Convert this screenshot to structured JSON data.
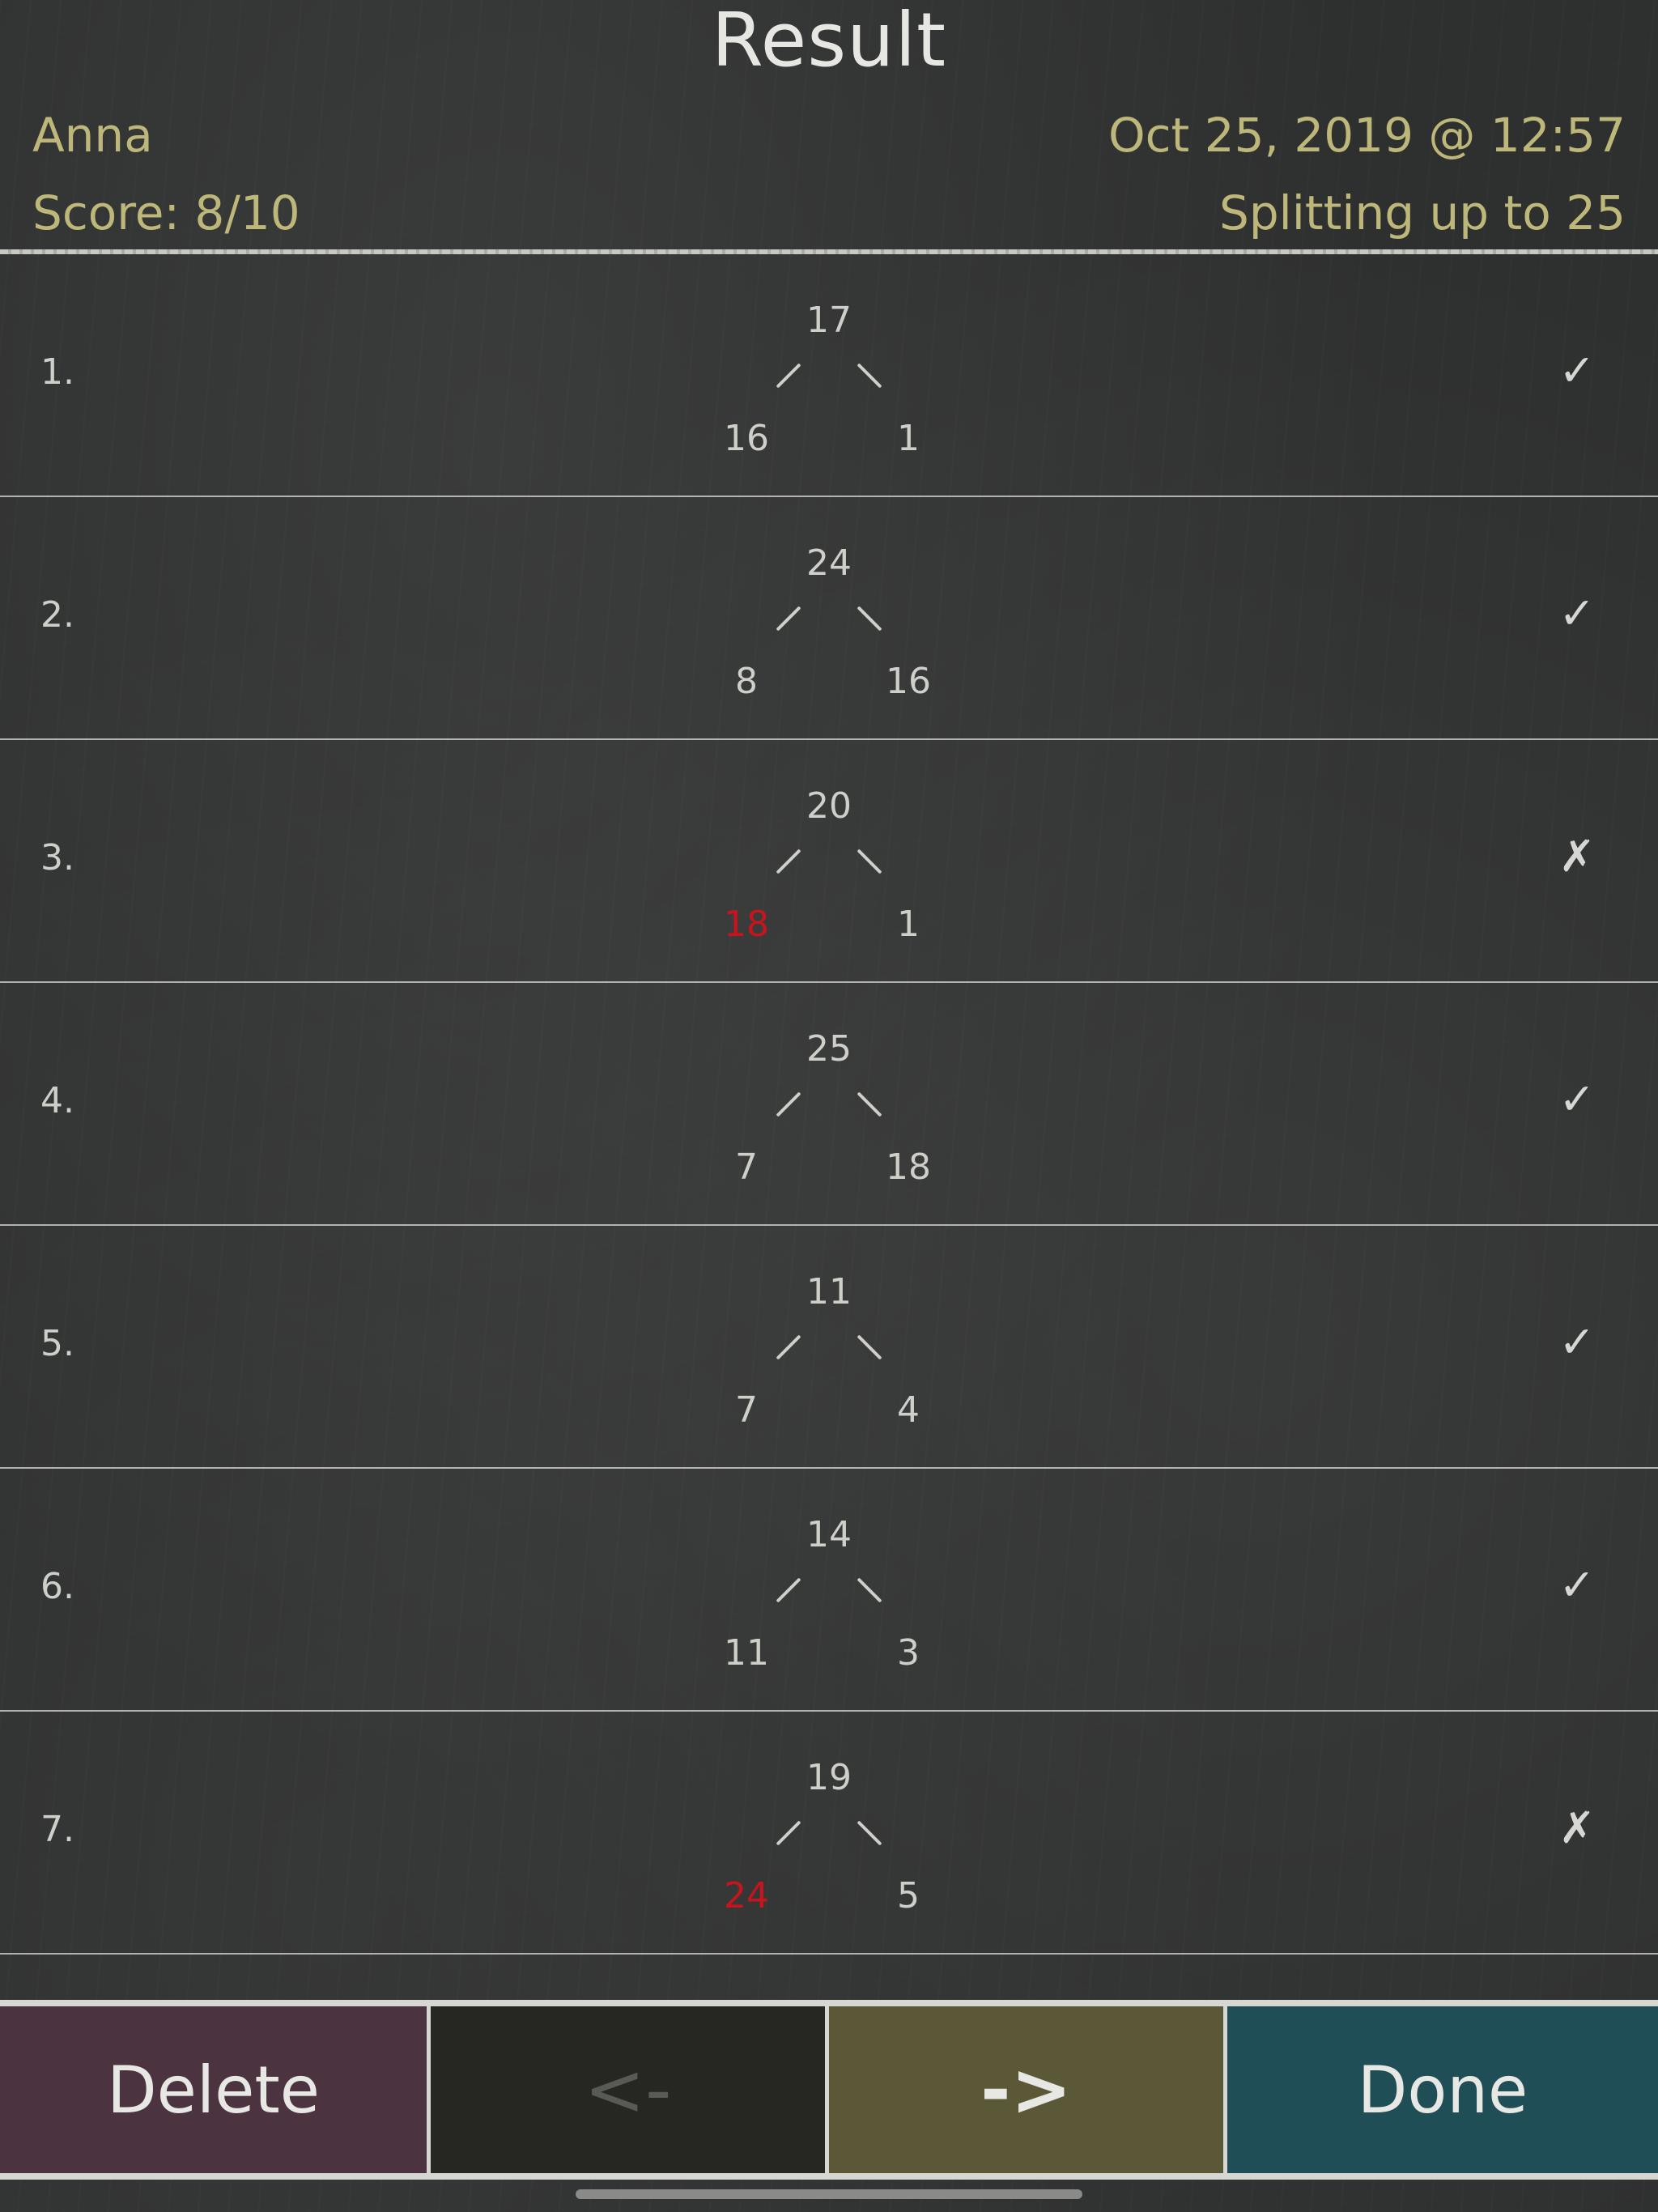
{
  "title": "Result",
  "meta": {
    "name": "Anna",
    "datetime": "Oct 25, 2019 @ 12:57",
    "score": "Score: 8/10",
    "mode": "Splitting up to 25"
  },
  "rows": [
    {
      "index": "1.",
      "total": "17",
      "left": "16",
      "right": "1",
      "mark": "✓",
      "left_wrong": false,
      "right_wrong": false
    },
    {
      "index": "2.",
      "total": "24",
      "left": "8",
      "right": "16",
      "mark": "✓",
      "left_wrong": false,
      "right_wrong": false
    },
    {
      "index": "3.",
      "total": "20",
      "left": "18",
      "right": "1",
      "mark": "✗",
      "left_wrong": true,
      "right_wrong": false
    },
    {
      "index": "4.",
      "total": "25",
      "left": "7",
      "right": "18",
      "mark": "✓",
      "left_wrong": false,
      "right_wrong": false
    },
    {
      "index": "5.",
      "total": "11",
      "left": "7",
      "right": "4",
      "mark": "✓",
      "left_wrong": false,
      "right_wrong": false
    },
    {
      "index": "6.",
      "total": "14",
      "left": "11",
      "right": "3",
      "mark": "✓",
      "left_wrong": false,
      "right_wrong": false
    },
    {
      "index": "7.",
      "total": "19",
      "left": "24",
      "right": "5",
      "mark": "✗",
      "left_wrong": true,
      "right_wrong": false
    }
  ],
  "toolbar": {
    "delete_label": "Delete",
    "prev_label": "<-",
    "next_label": "->",
    "done_label": "Done"
  },
  "colors": {
    "meta_text": "#bdb77a",
    "wrong_answer": "#c8141c",
    "delete_bg": "#4b3340",
    "next_bg": "#5a5836",
    "done_bg": "#1f4e57"
  }
}
